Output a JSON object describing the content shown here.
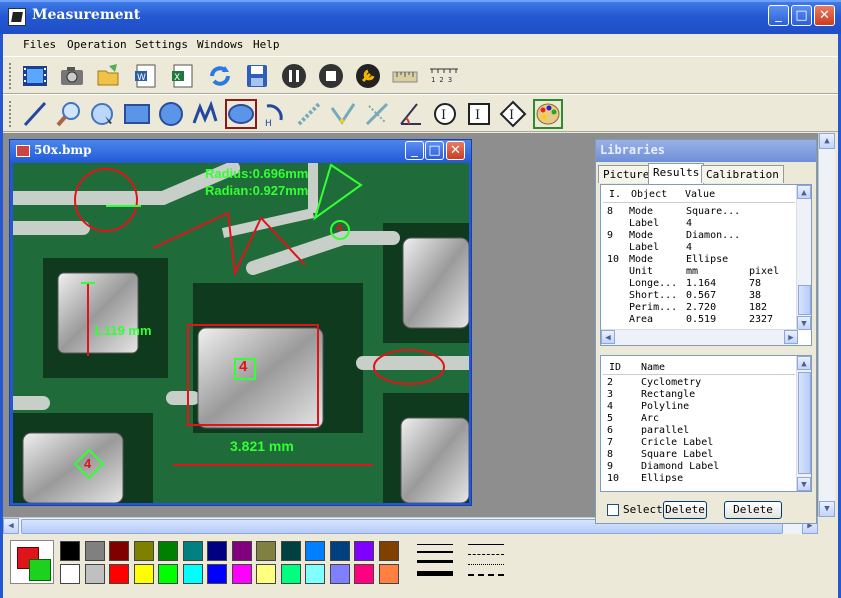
{
  "window": {
    "title": "Measurement"
  },
  "menu": [
    "Files",
    "Operation",
    "Settings",
    "Windows",
    "Help"
  ],
  "image_window": {
    "title": "50x.bmp"
  },
  "overlay": {
    "radius": "Radius:0.696mm",
    "radian": "Radian:0.927mm",
    "label_small": "4",
    "label_square": "4",
    "label_diamond": "4",
    "length_vertical": "1.119 mm",
    "length_horizontal": "3.821 mm"
  },
  "libraries": {
    "title": "Libraries",
    "tabs": [
      "Picture",
      "Results",
      "Calibration"
    ],
    "results": {
      "headers": [
        "I.",
        "Object",
        "Value"
      ],
      "rows": [
        [
          "8",
          "Mode",
          "Square...",
          ""
        ],
        [
          "",
          "Label",
          "4",
          ""
        ],
        [
          "9",
          "Mode",
          "Diamon...",
          ""
        ],
        [
          "",
          "Label",
          "4",
          ""
        ],
        [
          "10",
          "Mode",
          "Ellipse",
          ""
        ],
        [
          "",
          "Unit",
          "mm",
          "pixel"
        ],
        [
          "",
          "Longe...",
          "1.164",
          "78"
        ],
        [
          "",
          "Short...",
          "0.567",
          "38"
        ],
        [
          "",
          "Perim...",
          "2.720",
          "182"
        ],
        [
          "",
          "Area",
          "0.519",
          "2327"
        ]
      ]
    },
    "objects": {
      "headers": [
        "ID",
        "Name"
      ],
      "rows": [
        [
          "2",
          "Cyclometry"
        ],
        [
          "3",
          "Rectangle"
        ],
        [
          "4",
          "Polyline"
        ],
        [
          "5",
          "Arc"
        ],
        [
          "6",
          "parallel"
        ],
        [
          "7",
          "Cricle Label"
        ],
        [
          "8",
          "Square Label"
        ],
        [
          "9",
          "Diamond Label"
        ],
        [
          "10",
          "Ellipse"
        ]
      ]
    },
    "select_label": "Select",
    "delete_label_1": "Delete",
    "delete_label_2": "Delete"
  },
  "toolbar1_icons": [
    "film-icon",
    "camera-icon",
    "open-folder-icon",
    "word-doc-icon",
    "excel-icon",
    "refresh-icon",
    "save-icon",
    "pause-icon",
    "stop-icon",
    "wrench-icon",
    "ruler-icon",
    "scale-ruler-icon"
  ],
  "toolbar1_scale_text": "1 2 3",
  "toolbar2_icons": [
    "line-tool-icon",
    "zoom-tool-icon",
    "circle-select-icon",
    "rectangle-tool-icon",
    "circle-tool-icon",
    "polyline-tool-icon",
    "ellipse-tool-icon",
    "arc-tool-icon",
    "distance-tool-icon",
    "angle-tool-icon",
    "perpendicular-tool-icon",
    "angle-measure-icon",
    "circle-label-icon",
    "square-label-icon",
    "diamond-label-icon",
    "palette-icon"
  ],
  "colors": {
    "accent": "#2457d2",
    "overlay_red": "#e0141b",
    "overlay_green": "#33ff33",
    "palette_top": [
      "#000000",
      "#808080",
      "#800000",
      "#808000",
      "#008000",
      "#008080",
      "#000080",
      "#800080",
      "#808040",
      "#004040",
      "#0080ff",
      "#004080",
      "#8000ff",
      "#804000"
    ],
    "palette_bottom": [
      "#ffffff",
      "#c0c0c0",
      "#ff0000",
      "#ffff00",
      "#00ff00",
      "#00ffff",
      "#0000ff",
      "#ff00ff",
      "#ffff80",
      "#00ff80",
      "#80ffff",
      "#8080ff",
      "#ff0080",
      "#ff8040"
    ]
  }
}
